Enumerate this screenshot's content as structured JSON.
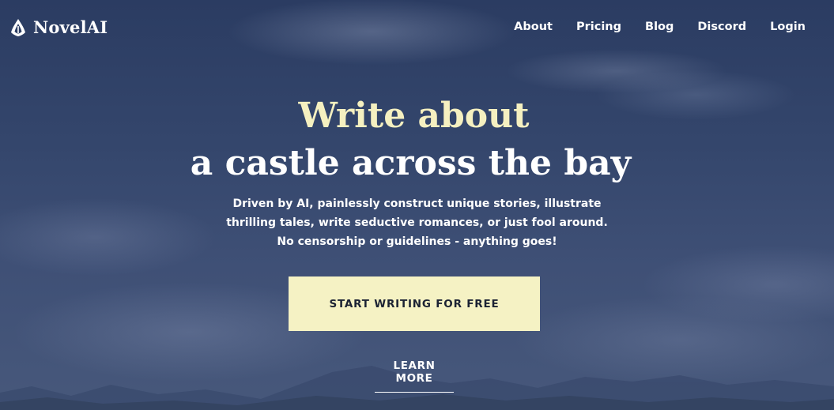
{
  "brand": {
    "name": "NovelAI",
    "icon": "novelai-quill-logo-icon"
  },
  "nav": {
    "items": [
      {
        "label": "About"
      },
      {
        "label": "Pricing"
      },
      {
        "label": "Blog"
      },
      {
        "label": "Discord"
      },
      {
        "label": "Login"
      }
    ]
  },
  "hero": {
    "headline_accent": "Write about",
    "headline_main": "a castle across the bay",
    "description": "Driven by AI, painlessly construct unique stories, illustrate thrilling tales, write seductive romances, or just fool around. No censorship or guidelines - anything goes!",
    "cta_label": "START WRITING FOR FREE",
    "learn_more_label": "LEARN MORE"
  },
  "colors": {
    "accent": "#f5f2c4",
    "headline_accent": "#f5f0c0",
    "background": "#34466c",
    "text": "#ffffff"
  }
}
